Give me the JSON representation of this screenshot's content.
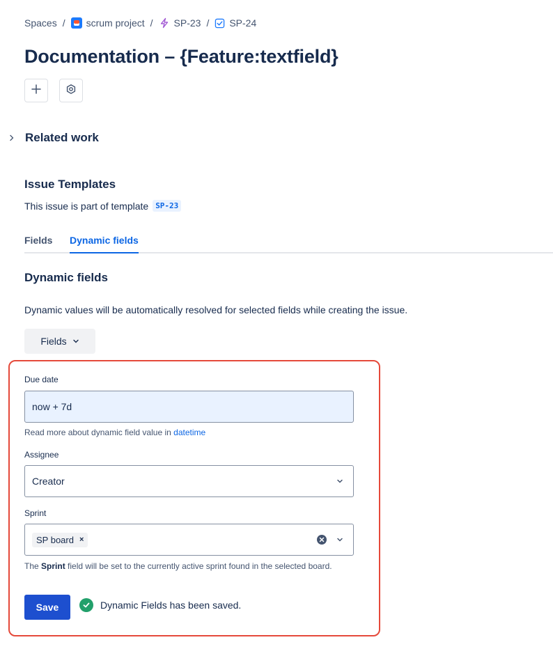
{
  "breadcrumb": {
    "spaces": "Spaces",
    "project": "scrum project",
    "epic": "SP-23",
    "task": "SP-24",
    "separator": "/"
  },
  "page": {
    "title": "Documentation – {Feature:textfield}"
  },
  "related_work": {
    "label": "Related work"
  },
  "templates": {
    "heading": "Issue Templates",
    "text": "This issue is part of template",
    "badge": "SP-23"
  },
  "tabs": [
    {
      "label": "Fields",
      "active": false
    },
    {
      "label": "Dynamic fields",
      "active": true
    }
  ],
  "dynamic": {
    "heading": "Dynamic fields",
    "description": "Dynamic values will be automatically resolved for selected fields while creating the issue.",
    "fields_dropdown": "Fields"
  },
  "form": {
    "due_date": {
      "label": "Due date",
      "value": "now + 7d",
      "help_text": "Read more about dynamic field value in",
      "help_link": "datetime"
    },
    "assignee": {
      "label": "Assignee",
      "value": "Creator"
    },
    "sprint": {
      "label": "Sprint",
      "chip": "SP board",
      "chip_remove": "×",
      "help_pre": "The",
      "help_bold": "Sprint",
      "help_post": "field will be set to the currently active sprint found in the selected board."
    },
    "save_label": "Save",
    "saved_message": "Dynamic Fields has been saved."
  },
  "colors": {
    "accent": "#0c66e4",
    "save_button": "#1d4fcf",
    "highlight_border": "#e5493a",
    "success": "#22a06b",
    "date_input_bg": "#e9f2ff"
  }
}
